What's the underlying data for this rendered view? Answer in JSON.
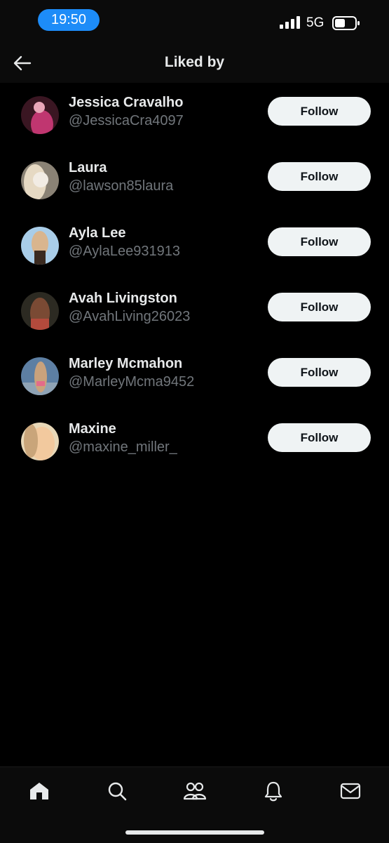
{
  "status_bar": {
    "time": "19:50",
    "network": "5G",
    "accent_color": "#1d8cf8"
  },
  "header": {
    "title": "Liked by",
    "back_icon": "arrow-left-icon"
  },
  "users": [
    {
      "name": "Jessica Cravalho",
      "handle": "@JessicaCra4097",
      "button": "Follow",
      "avatar_colors": [
        "#3a1622",
        "#c03670",
        "#e9a6b8"
      ]
    },
    {
      "name": "Laura",
      "handle": "@lawson85laura",
      "button": "Follow",
      "avatar_colors": [
        "#8a8275",
        "#e6d9c3",
        "#f2ece4"
      ]
    },
    {
      "name": "Ayla Lee",
      "handle": "@AylaLee931913",
      "button": "Follow",
      "avatar_colors": [
        "#a9cde8",
        "#d9b58e",
        "#3a2a20"
      ]
    },
    {
      "name": "Avah Livingston",
      "handle": "@AvahLiving26023",
      "button": "Follow",
      "avatar_colors": [
        "#2c2a22",
        "#7a4a34",
        "#b34a3c"
      ]
    },
    {
      "name": "Marley Mcmahon",
      "handle": "@MarleyMcma9452",
      "button": "Follow",
      "avatar_colors": [
        "#5d7fa3",
        "#c9a27c",
        "#e36b8a"
      ]
    },
    {
      "name": "Maxine",
      "handle": "@maxine_miller_",
      "button": "Follow",
      "avatar_colors": [
        "#e8d8b8",
        "#f2c99e",
        "#c9a57a"
      ]
    }
  ],
  "bottom_nav": {
    "items": [
      "home-icon",
      "search-icon",
      "communities-icon",
      "notifications-icon",
      "messages-icon"
    ]
  }
}
